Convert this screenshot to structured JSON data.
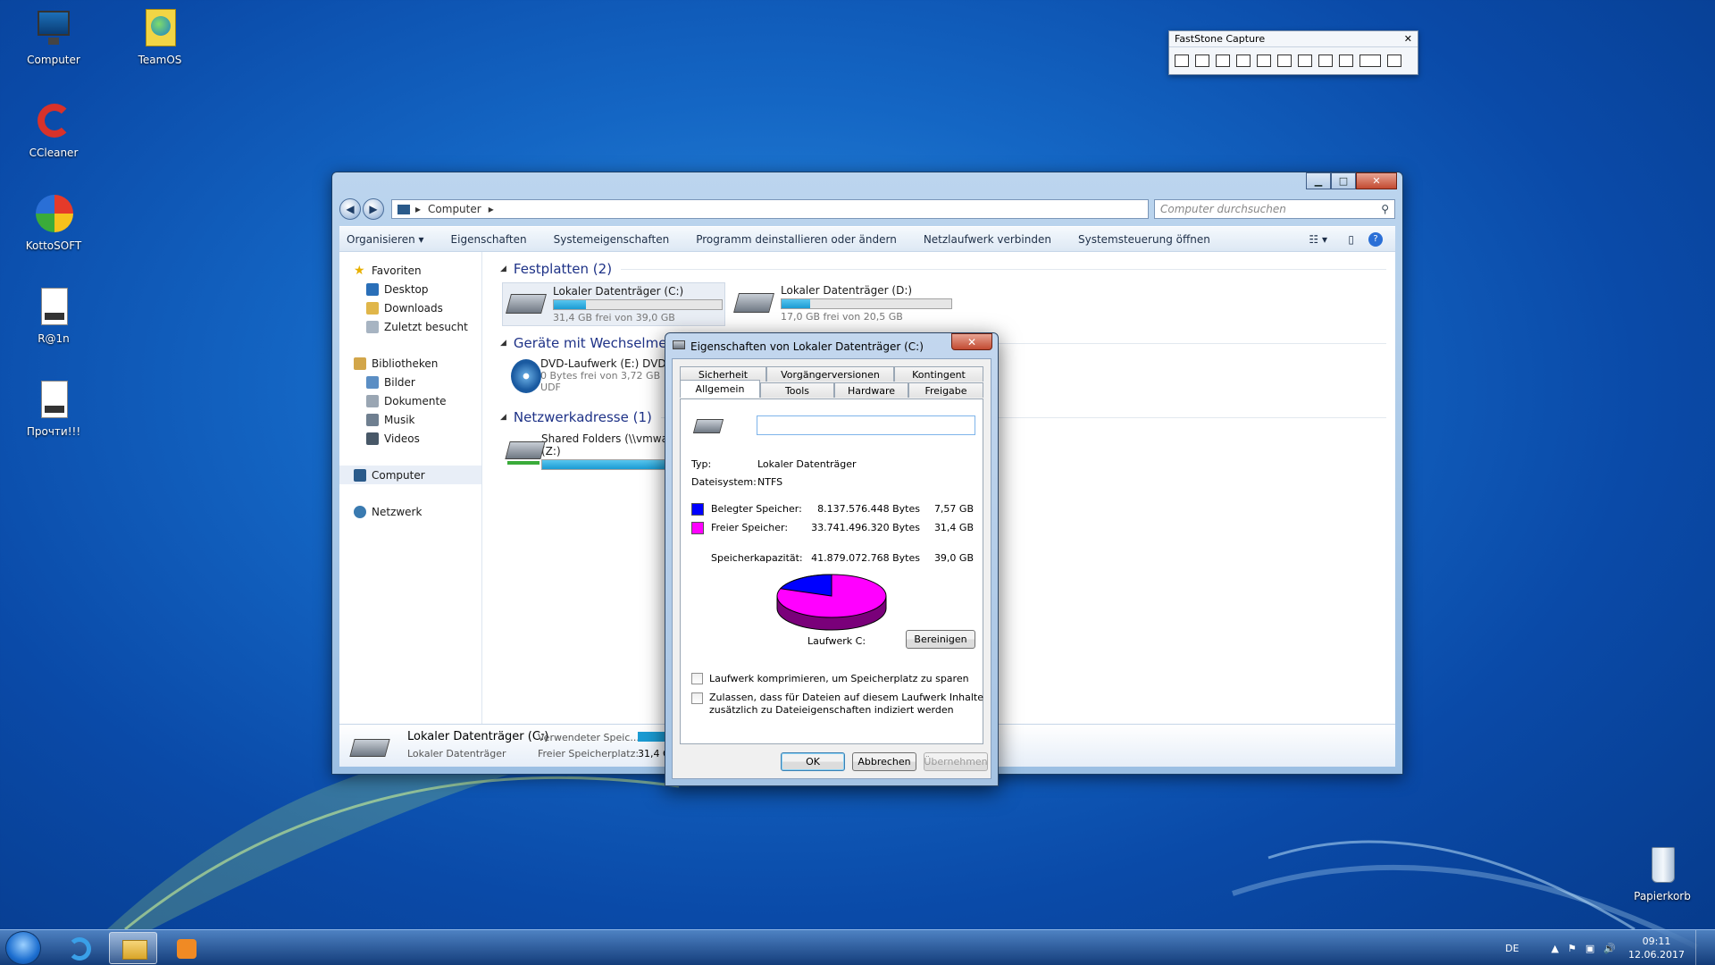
{
  "desktop": {
    "icons": [
      {
        "label": "Computer"
      },
      {
        "label": "TeamOS"
      },
      {
        "label": "CCleaner"
      },
      {
        "label": "KottoSOFT"
      },
      {
        "label": "R@1n"
      },
      {
        "label": "Прочти!!!"
      },
      {
        "label": "Papierkorb"
      }
    ]
  },
  "faststone": {
    "title": "FastStone Capture",
    "close": "✕"
  },
  "explorer": {
    "address": "Computer",
    "search_placeholder": "Computer durchsuchen",
    "toolbar": [
      "Organisieren ▾",
      "Eigenschaften",
      "Systemeigenschaften",
      "Programm deinstallieren oder ändern",
      "Netzlaufwerk verbinden",
      "Systemsteuerung öffnen"
    ],
    "nav": {
      "favorites": "Favoriten",
      "desktop": "Desktop",
      "downloads": "Downloads",
      "recent": "Zuletzt besucht",
      "libraries": "Bibliotheken",
      "pictures": "Bilder",
      "documents": "Dokumente",
      "music": "Musik",
      "videos": "Videos",
      "computer": "Computer",
      "network": "Netzwerk"
    },
    "groups": {
      "hdd": "Festplatten (2)",
      "removable": "Geräte mit Wechselmedien",
      "network": "Netzwerkadresse (1)"
    },
    "drives": {
      "c_name": "Lokaler Datenträger (C:)",
      "c_free": "31,4 GB frei von 39,0 GB",
      "c_used_fraction": 0.19,
      "d_name": "Lokaler Datenträger (D:)",
      "d_free": "17,0 GB frei von 20,5 GB",
      "d_used_fraction": 0.17,
      "dvd_name": "DVD-Laufwerk (E:) DVD_R",
      "dvd_free": "0 Bytes frei von 3,72 GB",
      "dvd_fs": "UDF",
      "share_name": "Shared Folders (\\\\vmware",
      "share_letter": "(Z:)",
      "share_used_fraction": 0.9
    },
    "details": {
      "name": "Lokaler Datenträger (C:)",
      "type": "Lokaler Datenträger",
      "used_label": "Verwendeter Speic...",
      "free_label": "Freier Speicherplatz:",
      "free_value": "31,4 G"
    }
  },
  "dialog": {
    "title": "Eigenschaften von Lokaler Datenträger (C:)",
    "tabs_top": [
      "Sicherheit",
      "Vorgängerversionen",
      "Kontingent"
    ],
    "tabs_bottom": [
      "Allgemein",
      "Tools",
      "Hardware",
      "Freigabe"
    ],
    "label_value": "",
    "type_label": "Typ:",
    "type_value": "Lokaler Datenträger",
    "fs_label": "Dateisystem:",
    "fs_value": "NTFS",
    "used_label": "Belegter Speicher:",
    "used_bytes": "8.137.576.448 Bytes",
    "used_gb": "7,57 GB",
    "free_label": "Freier Speicher:",
    "free_bytes": "33.741.496.320 Bytes",
    "free_gb": "31,4 GB",
    "cap_label": "Speicherkapazität:",
    "cap_bytes": "41.879.072.768 Bytes",
    "cap_gb": "39,0 GB",
    "drive_label": "Laufwerk C:",
    "cleanup": "Bereinigen",
    "chk1": "Laufwerk komprimieren, um Speicherplatz zu sparen",
    "chk2a": "Zulassen, dass für Dateien auf diesem Laufwerk Inhalte",
    "chk2b": "zusätzlich zu Dateieigenschaften indiziert werden",
    "ok": "OK",
    "cancel": "Abbrechen",
    "apply": "Übernehmen",
    "used_color": "#0000ff",
    "free_color": "#ff00ff"
  },
  "taskbar": {
    "lang": "DE",
    "time": "09:11",
    "date": "12.06.2017"
  }
}
